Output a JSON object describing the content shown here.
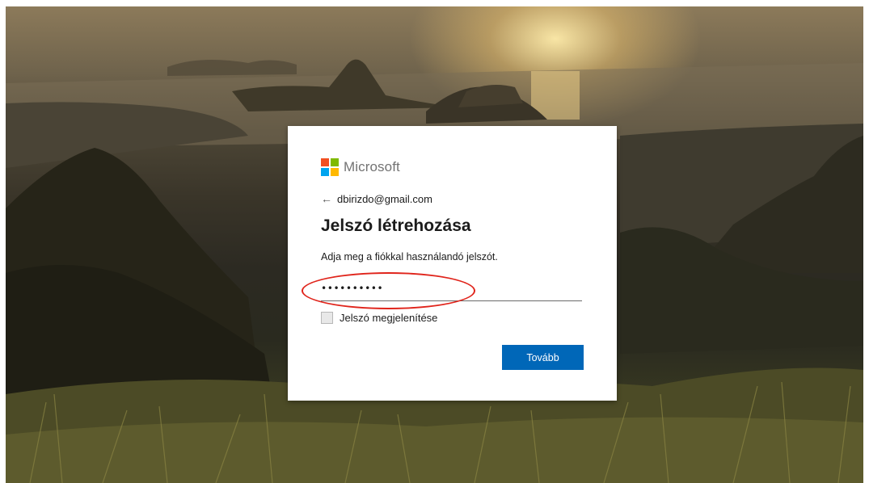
{
  "brand": {
    "name": "Microsoft",
    "colors": {
      "red": "#f25022",
      "green": "#7fba00",
      "blue": "#00a4ef",
      "yellow": "#ffb900"
    }
  },
  "identity": {
    "back_icon": "back-arrow-icon",
    "back_glyph": "←",
    "email": "dbirizdo@gmail.com"
  },
  "form": {
    "title": "Jelszó létrehozása",
    "description": "Adja meg a fiókkal használandó jelszót.",
    "password_value": "••••••••••",
    "show_password_label": "Jelszó megjelenítése",
    "show_password_checked": false,
    "next_label": "Tovább",
    "accent_color": "#0067b8"
  },
  "annotation": {
    "color": "#e0241b"
  }
}
